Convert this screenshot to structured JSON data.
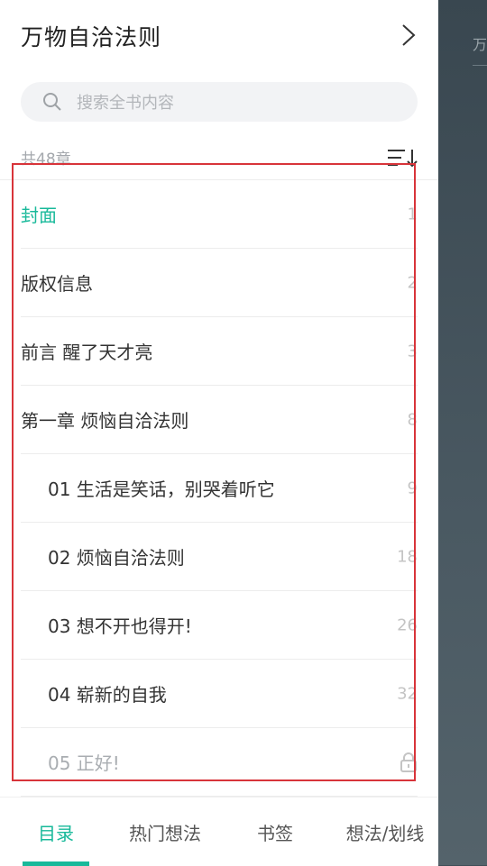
{
  "book": {
    "title": "万物自洽法则"
  },
  "search": {
    "placeholder": "搜索全书内容"
  },
  "toc": {
    "count_label": "共48章",
    "items": [
      {
        "label": "封面",
        "page": "1",
        "level": 0,
        "state": "active"
      },
      {
        "label": "版权信息",
        "page": "2",
        "level": 0,
        "state": "normal"
      },
      {
        "label": "前言 醒了天才亮",
        "page": "3",
        "level": 0,
        "state": "normal"
      },
      {
        "label": "第一章 烦恼自洽法则",
        "page": "8",
        "level": 0,
        "state": "normal"
      },
      {
        "label": "01 生活是笑话，别哭着听它",
        "page": "9",
        "level": 1,
        "state": "normal"
      },
      {
        "label": "02 烦恼自洽法则",
        "page": "18",
        "level": 1,
        "state": "normal"
      },
      {
        "label": "03 想不开也得开!",
        "page": "26",
        "level": 1,
        "state": "normal"
      },
      {
        "label": "04 崭新的自我",
        "page": "32",
        "level": 1,
        "state": "normal"
      },
      {
        "label": "05 正好!",
        "page": "",
        "level": 1,
        "state": "locked"
      }
    ]
  },
  "tabs": [
    {
      "label": "目录",
      "active": true
    },
    {
      "label": "热门想法",
      "active": false
    },
    {
      "label": "书签",
      "active": false
    },
    {
      "label": "想法/划线",
      "active": false
    }
  ],
  "backdrop": {
    "peek_text": "万"
  },
  "colors": {
    "accent": "#18b99a",
    "highlight_box": "#d8343a"
  }
}
